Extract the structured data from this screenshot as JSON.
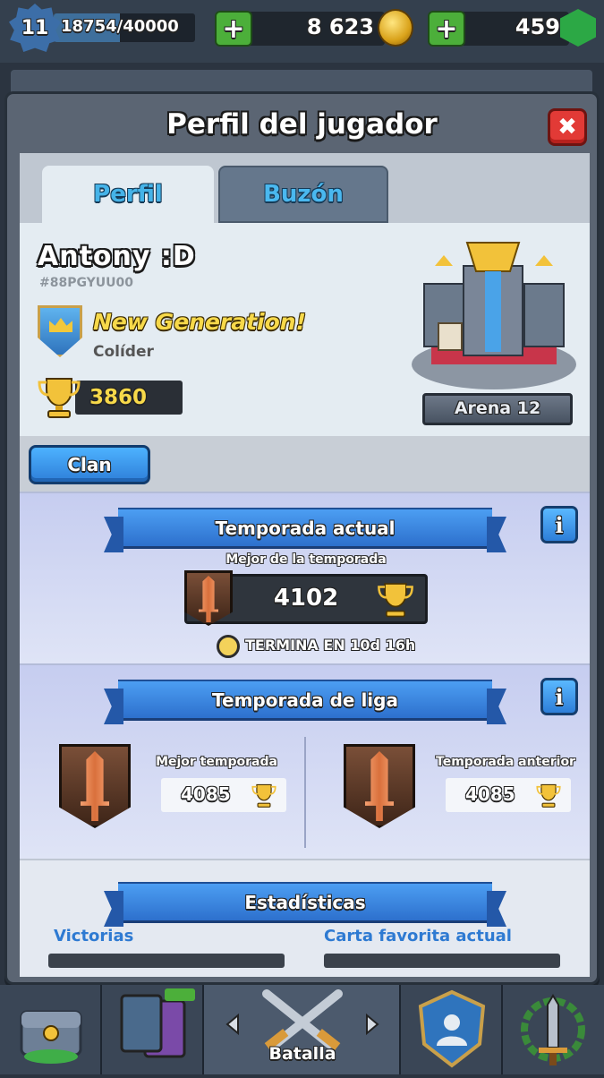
{
  "topbar": {
    "level": "11",
    "xp": "18754/40000",
    "xp_fraction": 0.469,
    "gold": "8 623",
    "gems": "459"
  },
  "behind": {
    "name": "Antony :D"
  },
  "panel": {
    "title": "Perfil del jugador",
    "close_icon": "close-icon"
  },
  "tabs": [
    {
      "label": "Perfil",
      "active": true
    },
    {
      "label": "Buzón",
      "active": false
    }
  ],
  "profile": {
    "name": "Antony :D",
    "tag": "#88PGYUU00",
    "clan_name": "New Generation!",
    "clan_role": "Colíder",
    "trophies": "3860",
    "arena": "Arena 12"
  },
  "clan_button": "Clan",
  "current_season": {
    "title": "Temporada actual",
    "best_label": "Mejor de la temporada",
    "best_value": "4102",
    "ends": "TERMINA EN 10d 16h"
  },
  "league_season": {
    "title": "Temporada de liga",
    "best_label": "Mejor temporada",
    "best_value": "4085",
    "prev_label": "Temporada anterior",
    "prev_value": "4085"
  },
  "stats": {
    "title": "Estadísticas",
    "wins_label": "Victorias",
    "fav_card_label": "Carta favorita actual"
  },
  "bottomnav": {
    "battle_label": "Batalla",
    "badge": ""
  },
  "colors": {
    "accent_blue": "#2e7ad2",
    "gold": "#f7d94a",
    "close_red": "#e23a36"
  }
}
